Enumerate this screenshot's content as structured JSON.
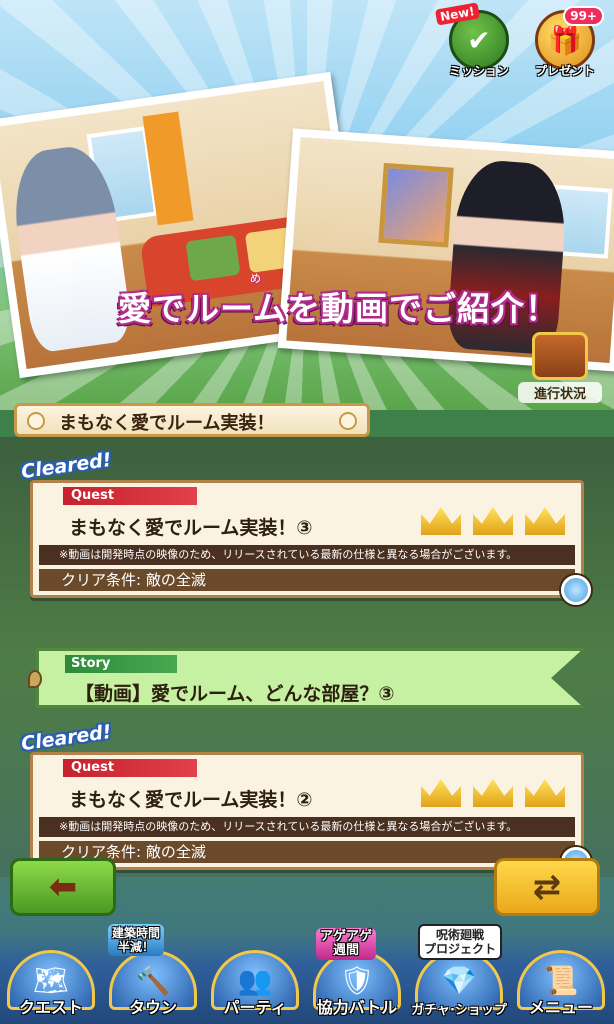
{
  "banner": {
    "title": "愛でルームを動画でご紹介！",
    "ruby": "め",
    "mission": {
      "new_label": "New!",
      "label": "ミッション"
    },
    "present": {
      "badge": "99+",
      "label": "プレゼント"
    },
    "progress": {
      "label": "進行状況"
    }
  },
  "section": {
    "title": "まもなく愛でルーム実装！"
  },
  "items": [
    {
      "type": "quest",
      "cleared": "Cleared!",
      "tag": "Quest",
      "title": "まもなく愛でルーム実装！③",
      "note": "※動画は開発時点の映像のため、リリースされている最新の仕様と異なる場合がございます。",
      "condition": "クリア条件: 敵の全滅",
      "crowns": 3
    },
    {
      "type": "story",
      "tag": "Story",
      "title": "【動画】愛でルーム、どんな部屋？③"
    },
    {
      "type": "quest",
      "cleared": "Cleared!",
      "tag": "Quest",
      "title": "まもなく愛でルーム実装！②",
      "note": "※動画は開発時点の映像のため、リリースされている最新の仕様と異なる場合がございます。",
      "condition": "クリア条件: 敵の全滅",
      "crowns": 3
    }
  ],
  "controls": {
    "back_icon": "arrow-left-icon",
    "sort_icon": "swap-arrows-icon"
  },
  "promos": {
    "build": "建築時間\n半減！",
    "week": "アゲアゲ\n週間",
    "collab": "呪術廻戦\nプロジェクト"
  },
  "nav": [
    {
      "label": "クエスト",
      "icon": "map-icon"
    },
    {
      "label": "タウン",
      "icon": "hammer-icon"
    },
    {
      "label": "パーティ",
      "icon": "people-icon"
    },
    {
      "label": "協力バトル",
      "icon": "shield-icon"
    },
    {
      "label": "ガチャ·ショップ",
      "icon": "gem-icon"
    },
    {
      "label": "メニュー",
      "icon": "scroll-icon"
    }
  ]
}
